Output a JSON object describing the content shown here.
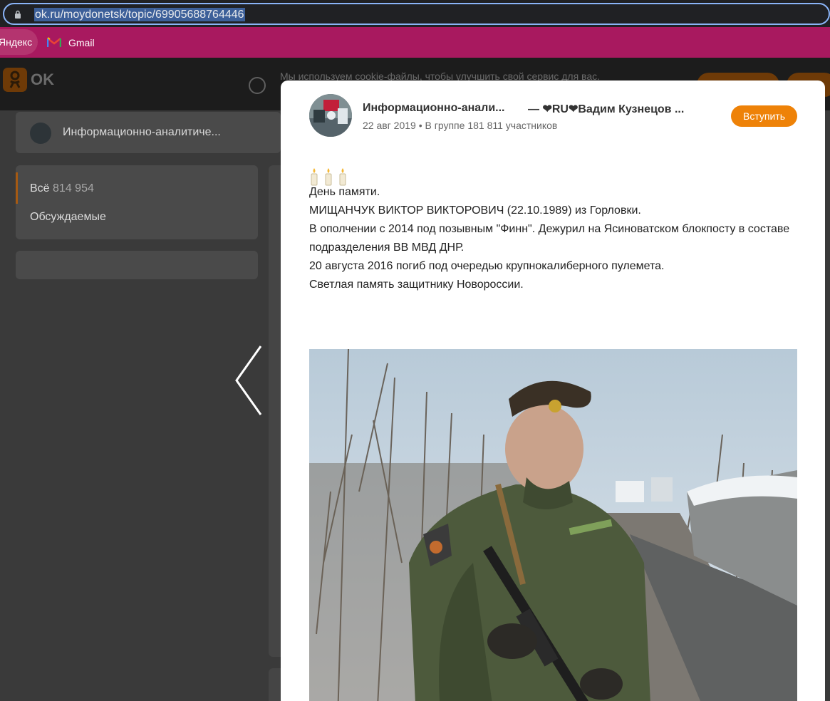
{
  "browser": {
    "url": "ok.ru/moydonetsk/topic/69905688764446",
    "bookmarks": [
      {
        "label": "Яндекс"
      },
      {
        "label": "Gmail"
      }
    ]
  },
  "ok_header": {
    "logo": "OK",
    "cookie_notice": "Мы используем cookie-файлы, чтобы улучшить свой сервис для вас."
  },
  "group_bar": {
    "name": "Информационно-аналитиче..."
  },
  "filters": {
    "all_label": "Всё",
    "all_count": "814 954",
    "discussed_label": "Обсуждаемые"
  },
  "post": {
    "group_title": "Информационно-анали...",
    "author": "— ❤︎RU❤︎Вадим Кузнецов ...",
    "date": "22 авг 2019",
    "meta_sep": " • ",
    "group_info": "В группе 181 811 участников",
    "join_label": "Вступить",
    "lines": [
      "День памяти.",
      "МИЩАНЧУК ВИКТОР ВИКТОРОВИЧ (22.10.1989) из Горловки.",
      "В ополчении с 2014 под позывным \"Финн\". Дежурил на Ясиноватском блокпосту в составе подразделения ВВ МВД ДНР.",
      "20 августа 2016 погиб под очередью крупнокалиберного пулемета.",
      "Светлая память защитнику Новороссии."
    ]
  },
  "colors": {
    "accent": "#ee8208",
    "bookmark_bar": "#a8195f",
    "url_highlight": "#3c5f99"
  },
  "icons": [
    "lock-icon",
    "gmail-icon",
    "ok-logo-icon",
    "cookie-icon",
    "chevron-left-icon",
    "candle-icon"
  ]
}
